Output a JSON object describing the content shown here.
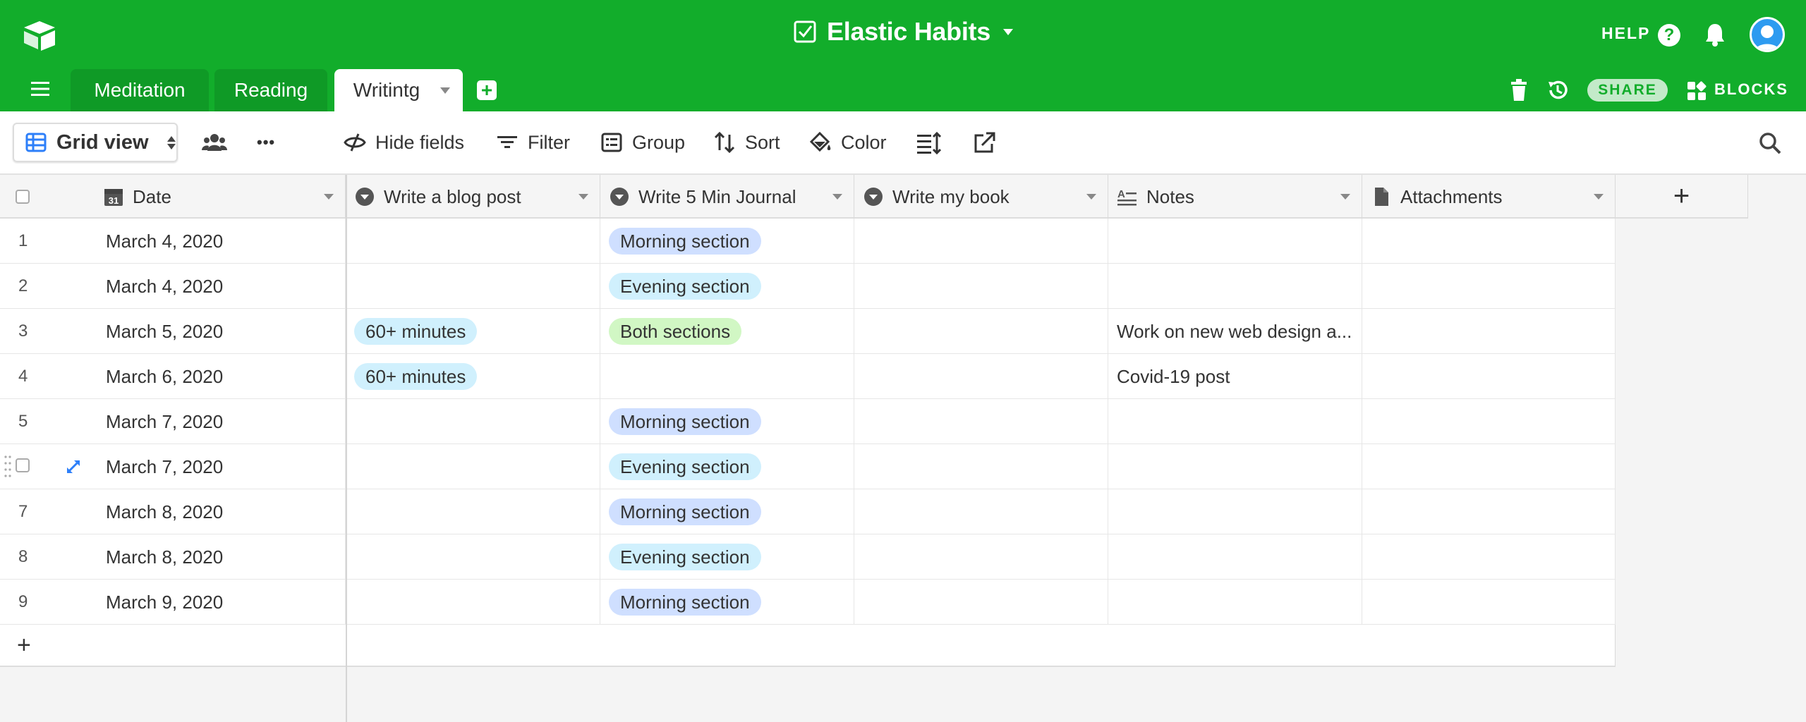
{
  "header": {
    "title": "Elastic Habits",
    "help_label": "HELP",
    "help_glyph": "?",
    "share_label": "SHARE",
    "blocks_label": "BLOCKS",
    "brand_color": "#12ad2b"
  },
  "tabs": [
    {
      "label": "Meditation",
      "active": false
    },
    {
      "label": "Reading",
      "active": false
    },
    {
      "label": "Writintg",
      "active": true
    }
  ],
  "add_tab_glyph": "+",
  "toolbar": {
    "view_label": "Grid view",
    "more_glyph": "•••",
    "hide_fields": "Hide fields",
    "filter": "Filter",
    "group": "Group",
    "sort": "Sort",
    "color": "Color"
  },
  "columns": {
    "date": "Date",
    "blog": "Write a blog post",
    "journal": "Write 5 Min Journal",
    "book": "Write my book",
    "notes": "Notes",
    "attachments": "Attachments",
    "add_glyph": "+"
  },
  "rows": [
    {
      "num": "1",
      "date": "March 4, 2020",
      "blog": "",
      "journal": "Morning section",
      "notes": ""
    },
    {
      "num": "2",
      "date": "March 4, 2020",
      "blog": "",
      "journal": "Evening section",
      "notes": ""
    },
    {
      "num": "3",
      "date": "March 5, 2020",
      "blog": "60+ minutes",
      "journal": "Both sections",
      "notes": "Work on new web design a..."
    },
    {
      "num": "4",
      "date": "March 6, 2020",
      "blog": "60+ minutes",
      "journal": "",
      "notes": "Covid-19 post"
    },
    {
      "num": "5",
      "date": "March 7, 2020",
      "blog": "",
      "journal": "Morning section",
      "notes": ""
    },
    {
      "num": "6",
      "date": "March 7, 2020",
      "blog": "",
      "journal": "Evening section",
      "notes": ""
    },
    {
      "num": "7",
      "date": "March 8, 2020",
      "blog": "",
      "journal": "Morning section",
      "notes": ""
    },
    {
      "num": "8",
      "date": "March 8, 2020",
      "blog": "",
      "journal": "Evening section",
      "notes": ""
    },
    {
      "num": "9",
      "date": "March 9, 2020",
      "blog": "",
      "journal": "Morning section",
      "notes": ""
    }
  ],
  "add_row_glyph": "+",
  "pill_colors": {
    "Morning section": "#cfdfff",
    "Evening section": "#d0f0fd",
    "Both sections": "#d1f7c4",
    "60+ minutes": "#d0f0fd"
  }
}
